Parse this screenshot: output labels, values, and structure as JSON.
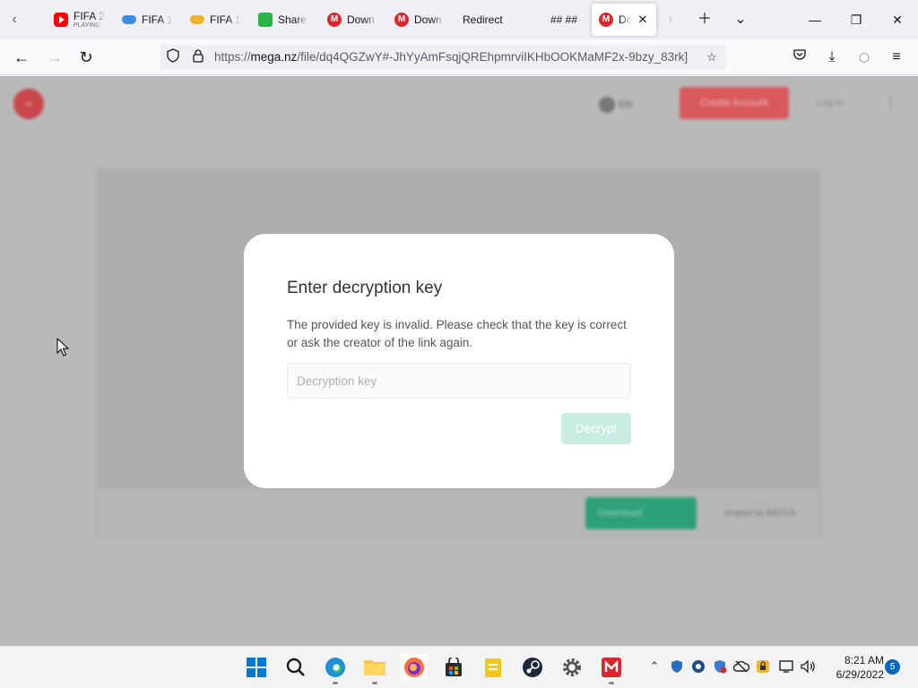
{
  "browser": {
    "tabs": [
      {
        "title": "FIFA 2",
        "subtitle": "PLAYING",
        "icon": "youtube-icon"
      },
      {
        "title": "FIFA 1",
        "icon": "gamepad-icon"
      },
      {
        "title": "FIFA 1",
        "icon": "gamepad-icon"
      },
      {
        "title": "Share",
        "icon": "share-icon"
      },
      {
        "title": "Down",
        "icon": "mega-icon"
      },
      {
        "title": "Down",
        "icon": "mega-icon"
      },
      {
        "title": "Redirect",
        "icon": ""
      },
      {
        "title": "## ##",
        "icon": ""
      },
      {
        "title": "Do",
        "icon": "mega-icon",
        "active": true
      }
    ],
    "url": {
      "prefix": "https://",
      "domain": "mega.nz",
      "path": "/file/dq4QGZwY#-JhYyAmFsqjQREhpmrviIKHbOOKMaMF2x-9bzy_83rk]"
    }
  },
  "page_background": {
    "logo_text": "M",
    "language": "EN",
    "create_account": "Create Account",
    "login": "Log in",
    "download": "Download",
    "import": "Import to MEGA"
  },
  "dialog": {
    "title": "Enter decryption key",
    "message": "The provided key is invalid. Please check that the key is correct or ask the creator of the link again.",
    "input_placeholder": "Decryption key",
    "input_value": "",
    "decrypt_label": "Decrypt"
  },
  "taskbar": {
    "apps": [
      "windows-start",
      "search",
      "edge",
      "file-explorer",
      "firefox",
      "microsoft-store",
      "notes",
      "steam",
      "settings",
      "mega"
    ],
    "time": "8:21 AM",
    "date": "6/29/2022",
    "notification_count": "5"
  },
  "colors": {
    "mega_red": "#d9272e",
    "decrypt_disabled": "#c9ece2",
    "download_green": "#2fa178",
    "accent_blue": "#0067c0"
  }
}
